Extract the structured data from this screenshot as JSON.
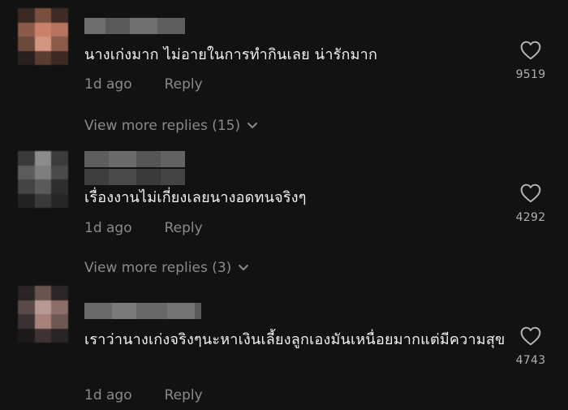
{
  "comments": [
    {
      "text": "นางเก่งมาก ไม่อายในการทำกินเลย น่ารักมาก",
      "time": "1d ago",
      "reply_label": "Reply",
      "likes": "9519",
      "more_replies": "View more replies (15)"
    },
    {
      "text": "เรื่องงานไม่เกี่ยงเลยนางอดทนจริงๆ",
      "time": "1d ago",
      "reply_label": "Reply",
      "likes": "4292",
      "more_replies": "View more replies (3)"
    },
    {
      "text": "เราว่านางเก่งจริงๆนะหาเงินเลี้ยงลูกเองมันเหนื่อยมากแต่มีความสุข",
      "time": "1d ago",
      "reply_label": "Reply",
      "likes": "4743"
    }
  ],
  "icons": {
    "like": "heart-outline-icon",
    "expand": "chevron-down-icon"
  },
  "colors": {
    "background": "#121212",
    "text": "#f2f2f2",
    "muted": "#8a8a8a"
  }
}
